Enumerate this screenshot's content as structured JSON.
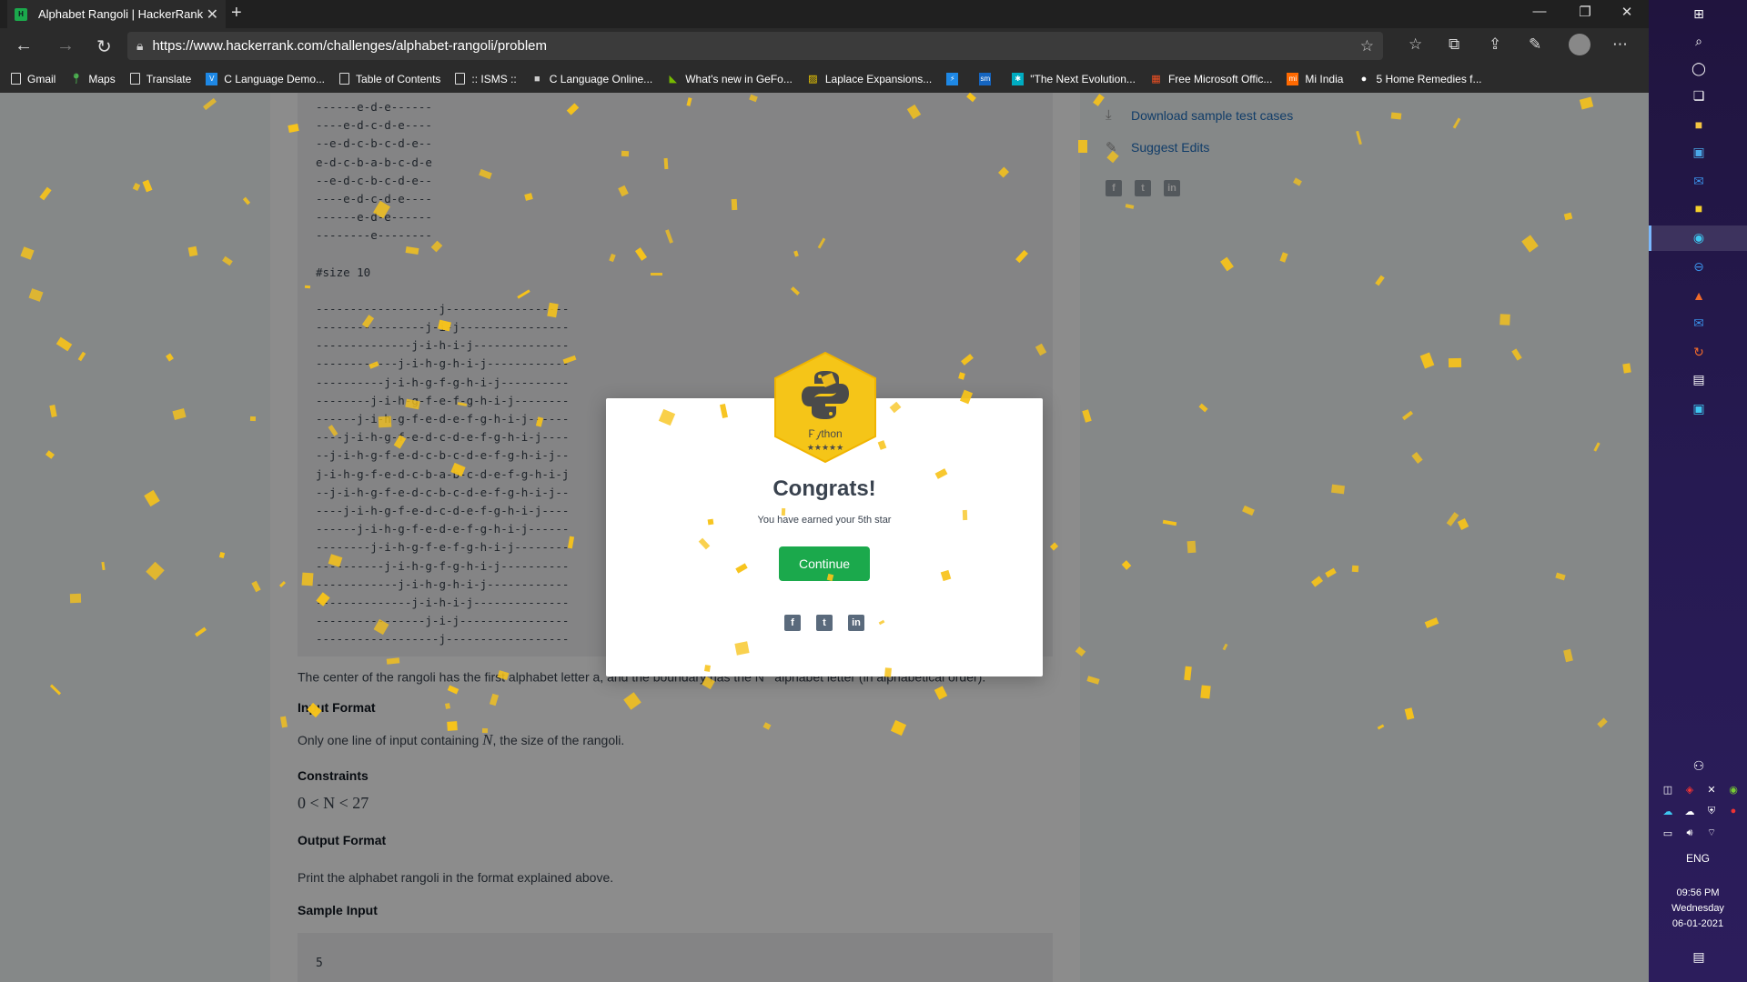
{
  "browser": {
    "tab_title": "Alphabet Rangoli | HackerRank",
    "favicon_text": "H",
    "url": "https://www.hackerrank.com/challenges/alphabet-rangoli/problem",
    "bookmarks": [
      {
        "label": "Gmail",
        "icon": "page-icon"
      },
      {
        "label": "Maps",
        "icon": "maps-pin-icon"
      },
      {
        "label": "Translate",
        "icon": "page-icon"
      },
      {
        "label": "C Language Demo...",
        "icon": "c-language-icon"
      },
      {
        "label": "Table of Contents",
        "icon": "page-icon"
      },
      {
        "label": ":: ISMS ::",
        "icon": "page-icon"
      },
      {
        "label": "C Language Online...",
        "icon": "c-online-icon"
      },
      {
        "label": "What's new in GeFo...",
        "icon": "nvidia-icon"
      },
      {
        "label": "Laplace Expansions...",
        "icon": "laplace-icon"
      },
      {
        "label": "",
        "icon": "app-blue-icon"
      },
      {
        "label": "",
        "icon": "sm-icon"
      },
      {
        "label": "\"The Next Evolution...",
        "icon": "evolution-icon"
      },
      {
        "label": "Free Microsoft Offic...",
        "icon": "microsoft-icon"
      },
      {
        "label": "Mi India",
        "icon": "mi-icon"
      },
      {
        "label": "5 Home Remedies f...",
        "icon": "remedies-icon"
      }
    ]
  },
  "problem": {
    "code_lines_size5_tail": [
      "------e-d-e------",
      "----e-d-c-d-e----",
      "--e-d-c-b-c-d-e--",
      "e-d-c-b-a-b-c-d-e",
      "--e-d-c-b-c-d-e--",
      "----e-d-c-d-e----",
      "------e-d-e------",
      "--------e--------"
    ],
    "size10_label": "#size 10",
    "code_lines_size10": [
      "------------------j------------------",
      "----------------j-i-j----------------",
      "--------------j-i-h-i-j--------------",
      "------------j-i-h-g-h-i-j------------",
      "----------j-i-h-g-f-g-h-i-j----------",
      "--------j-i-h-g-f-e-f-g-h-i-j--------",
      "------j-i-h-g-f-e-d-e-f-g-h-i-j------",
      "----j-i-h-g-f-e-d-c-d-e-f-g-h-i-j----",
      "--j-i-h-g-f-e-d-c-b-c-d-e-f-g-h-i-j--",
      "j-i-h-g-f-e-d-c-b-a-b-c-d-e-f-g-h-i-j",
      "--j-i-h-g-f-e-d-c-b-c-d-e-f-g-h-i-j--",
      "----j-i-h-g-f-e-d-c-d-e-f-g-h-i-j----",
      "------j-i-h-g-f-e-d-e-f-g-h-i-j------",
      "--------j-i-h-g-f-e-f-g-h-i-j--------",
      "----------j-i-h-g-f-g-h-i-j----------",
      "------------j-i-h-g-h-i-j------------",
      "--------------j-i-h-i-j--------------",
      "----------------j-i-j----------------",
      "------------------j------------------"
    ],
    "center_text": "The center of the rangoli has the first alphabet letter a, and the boundary has the N",
    "center_text_tail": "alphabet letter (in alphabetical order).",
    "input_format_heading": "Input Format",
    "input_format_text_pre": "Only one line of input containing",
    "input_format_var": "N",
    "input_format_text_post": ", the size of the rangoli.",
    "constraints_heading": "Constraints",
    "constraints_math": "0 < N < 27",
    "output_format_heading": "Output Format",
    "output_format_text": "Print the alphabet rangoli in the format explained above.",
    "sample_input_heading": "Sample Input",
    "sample_input_value": "5"
  },
  "sidebar": {
    "download_label": "Download sample test cases",
    "suggest_label": "Suggest Edits"
  },
  "modal": {
    "badge_language": "Python",
    "badge_stars": "★★★★★",
    "congrats_title": "Congrats!",
    "earned_text": "You have earned your 5th star",
    "continue_label": "Continue"
  },
  "taskbar": {
    "language": "ENG",
    "time": "09:56 PM",
    "day": "Wednesday",
    "date": "06-01-2021"
  },
  "colors": {
    "accent_green": "#1ba94c",
    "confetti": "#f7c31a",
    "badge_gold": "#f5c518"
  }
}
